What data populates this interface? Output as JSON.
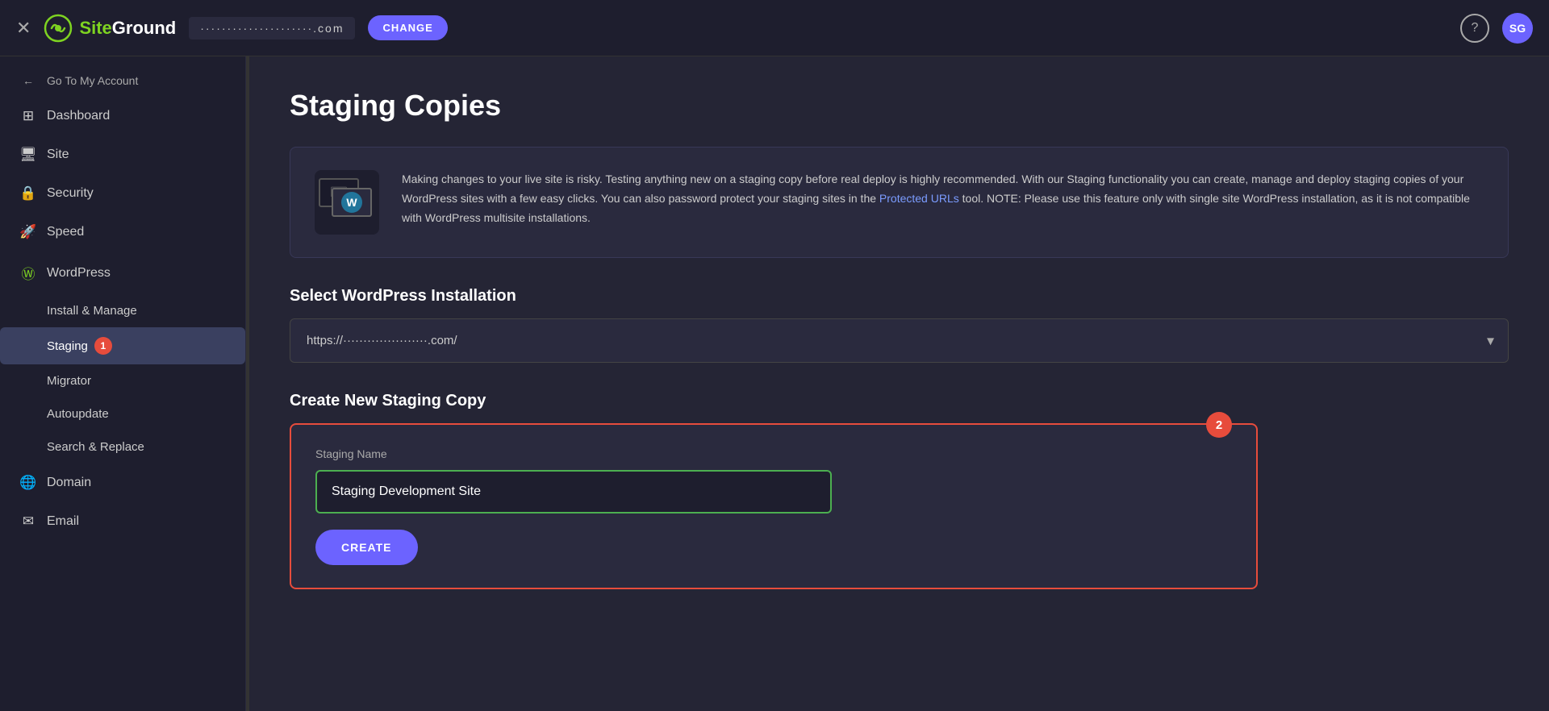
{
  "topbar": {
    "close_label": "✕",
    "logo_text_part1": "Site",
    "logo_text_part2": "Ground",
    "domain_text": "·····················.com",
    "change_label": "CHANGE",
    "help_label": "?",
    "avatar_label": "SG"
  },
  "sidebar": {
    "back_label": "Go To My Account",
    "items": [
      {
        "id": "dashboard",
        "label": "Dashboard",
        "icon": "⊞"
      },
      {
        "id": "site",
        "label": "Site",
        "icon": "🖥"
      },
      {
        "id": "security",
        "label": "Security",
        "icon": "🔒"
      },
      {
        "id": "speed",
        "label": "Speed",
        "icon": "🚀"
      },
      {
        "id": "wordpress",
        "label": "WordPress",
        "icon": "Ⓦ"
      }
    ],
    "sub_items": [
      {
        "id": "install-manage",
        "label": "Install & Manage"
      },
      {
        "id": "staging",
        "label": "Staging",
        "active": true,
        "badge": "1"
      },
      {
        "id": "migrator",
        "label": "Migrator"
      },
      {
        "id": "autoupdate",
        "label": "Autoupdate"
      },
      {
        "id": "search-replace",
        "label": "Search & Replace"
      }
    ],
    "bottom_items": [
      {
        "id": "domain",
        "label": "Domain",
        "icon": "🌐"
      },
      {
        "id": "email",
        "label": "Email",
        "icon": "✉"
      }
    ]
  },
  "content": {
    "page_title": "Staging Copies",
    "info_text": "Making changes to your live site is risky. Testing anything new on a staging copy before real deploy is highly recommended. With our Staging functionality you can create, manage and deploy staging copies of your WordPress sites with a few easy clicks. You can also password protect your staging sites in the Protected URLs tool. NOTE: Please use this feature only with single site WordPress installation, as it is not compatible with WordPress multisite installations.",
    "info_link_text": "Protected URLs",
    "select_section_title": "Select WordPress Installation",
    "dropdown_value": "https://·····················.com/",
    "create_section_title": "Create New Staging Copy",
    "staging_name_label": "Staging Name",
    "staging_name_value": "Staging Development Site",
    "create_btn_label": "CREATE",
    "badge_2_label": "2"
  }
}
